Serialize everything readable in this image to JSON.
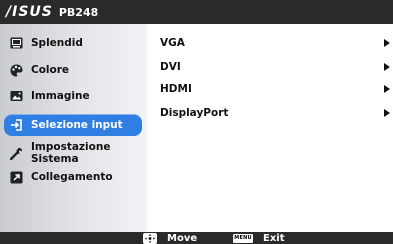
{
  "title_bar": {
    "brand": "/ISUS",
    "model": "PB248"
  },
  "sidebar": {
    "items": [
      {
        "label": "Splendid",
        "icon": "splendid-icon"
      },
      {
        "label": "Colore",
        "icon": "palette-icon"
      },
      {
        "label": "Immagine",
        "icon": "image-icon"
      },
      {
        "label": "Selezione input",
        "icon": "input-select-icon",
        "selected": true
      },
      {
        "label": "Impostazione Sistema",
        "icon": "wrench-icon"
      },
      {
        "label": "Collegamento",
        "icon": "shortcut-icon"
      }
    ]
  },
  "content": {
    "items": [
      {
        "label": "VGA",
        "icon": "arrow-right-icon"
      },
      {
        "label": "DVI",
        "icon": "arrow-right-icon"
      },
      {
        "label": "HDMI",
        "icon": "arrow-right-icon"
      },
      {
        "label": "DisplayPort",
        "icon": "arrow-right-icon"
      }
    ]
  },
  "footer": {
    "move_label": "Move",
    "menu_key": "MENU",
    "exit_label": "Exit"
  },
  "colors": {
    "selected": "#2f7fe3",
    "bar": "#2a2a2a"
  }
}
